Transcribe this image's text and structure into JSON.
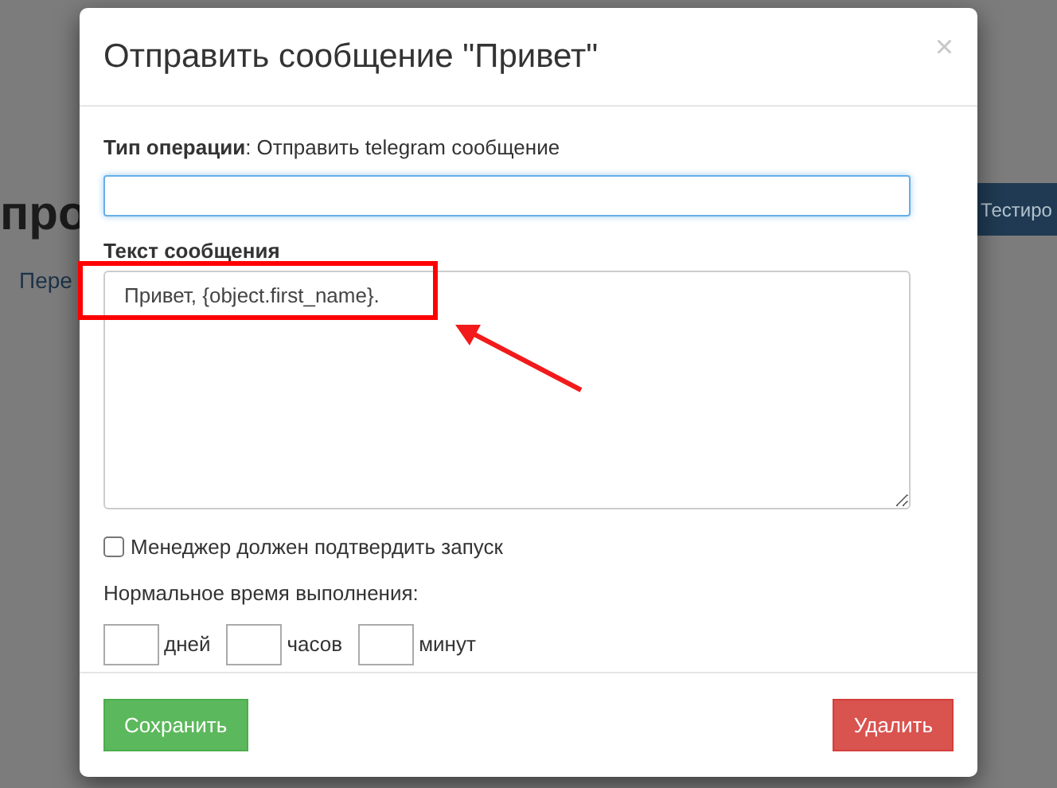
{
  "background": {
    "heading": "про",
    "link": "Пере",
    "button": "Тестиро"
  },
  "dialog": {
    "title": "Отправить сообщение \"Привет\"",
    "close": "×",
    "operation": {
      "label": "Тип операции",
      "value": ": Отправить telegram сообщение"
    },
    "message": {
      "label": "Текст сообщения",
      "value": "Привет, {object.first_name}."
    },
    "confirm": {
      "label": "Менеджер должен подтвердить запуск",
      "checked": false
    },
    "duration": {
      "label": "Нормальное время выполнения:",
      "units": [
        "дней",
        "часов",
        "минут"
      ]
    },
    "buttons": {
      "save": "Сохранить",
      "delete": "Удалить"
    }
  },
  "annotation": {
    "highlight": true,
    "arrow": true
  }
}
